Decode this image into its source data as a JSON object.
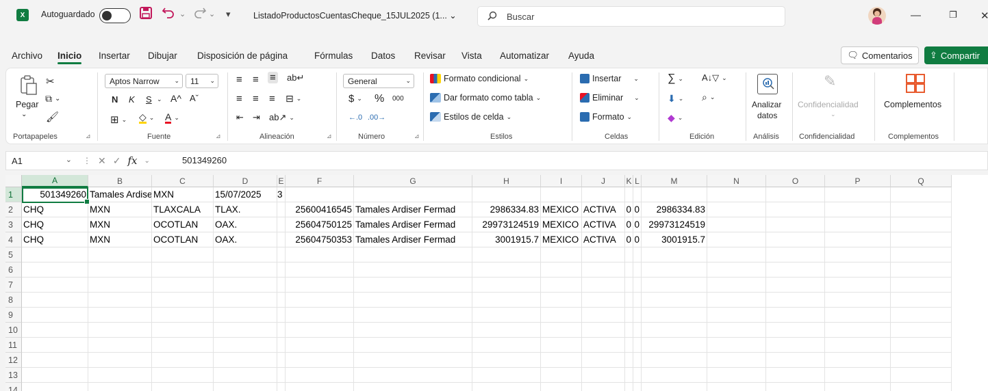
{
  "titlebar": {
    "autosave_label": "Autoguardado",
    "doc_title": "ListadoProductosCuentasCheque_15JUL2025 (1... ⌄",
    "search_placeholder": "Buscar",
    "logo_text": "X",
    "icons": [
      "save-icon",
      "undo-icon",
      "redo-icon",
      "customize-toolbar-icon",
      "search-icon"
    ]
  },
  "menu": {
    "tabs": [
      "Archivo",
      "Inicio",
      "Insertar",
      "Dibujar",
      "Disposición de página",
      "Fórmulas",
      "Datos",
      "Revisar",
      "Vista",
      "Automatizar",
      "Ayuda"
    ],
    "active_tab": "Inicio",
    "comments_label": "Comentarios",
    "share_label": "Compartir"
  },
  "ribbon": {
    "clipboard": {
      "paste_label": "Pegar",
      "group_label": "Portapapeles"
    },
    "font": {
      "font_name": "Aptos Narrow",
      "font_size": "11",
      "bold": "N",
      "italic": "K",
      "underline": "S",
      "grow": "A^",
      "shrink": "Aˇ",
      "group_label": "Fuente"
    },
    "alignment": {
      "group_label": "Alineación"
    },
    "number": {
      "format": "General",
      "currency": "$",
      "percent": "%",
      "thousands": "000",
      "group_label": "Número"
    },
    "styles": {
      "conditional": "Formato condicional",
      "as_table": "Dar formato como tabla",
      "cell_styles": "Estilos de celda",
      "group_label": "Estilos"
    },
    "cells": {
      "insert": "Insertar",
      "delete": "Eliminar",
      "format": "Formato",
      "group_label": "Celdas"
    },
    "editing": {
      "group_label": "Edición"
    },
    "analysis": {
      "analyze_label_1": "Analizar",
      "analyze_label_2": "datos",
      "group_label": "Análisis"
    },
    "sensitivity": {
      "button_label": "Confidencialidad",
      "group_label": "Confidencialidad"
    },
    "addins": {
      "button_label": "Complementos",
      "group_label": "Complementos"
    }
  },
  "formula_bar": {
    "name_box": "A1",
    "fx": "fx",
    "value": "501349260"
  },
  "sheet": {
    "columns": [
      "A",
      "B",
      "C",
      "D",
      "E",
      "F",
      "G",
      "H",
      "I",
      "J",
      "K",
      "L",
      "M",
      "N",
      "O",
      "P",
      "Q"
    ],
    "row_numbers": [
      "1",
      "2",
      "3",
      "4",
      "5",
      "6",
      "7",
      "8",
      "9",
      "10",
      "11",
      "12",
      "13",
      "14"
    ],
    "rows": [
      [
        "501349260",
        "Tamales Ardiser Fermad",
        "MXN",
        "15/07/2025",
        "3",
        "",
        "",
        "",
        "",
        "",
        "",
        "",
        ""
      ],
      [
        "CHQ",
        "MXN",
        "TLAXCALA",
        "TLAX.",
        "",
        "25600416545",
        "Tamales Ardiser Fermad",
        "2986334.83",
        "MEXICO",
        "ACTIVA",
        "0",
        "0",
        "2986334.83"
      ],
      [
        "CHQ",
        "MXN",
        "OCOTLAN",
        "OAX.",
        "",
        "25604750125",
        "Tamales Ardiser Fermad",
        "29973124519",
        "MEXICO",
        "ACTIVA",
        "0",
        "0",
        "29973124519"
      ],
      [
        "CHQ",
        "MXN",
        "OCOTLAN",
        "OAX.",
        "",
        "25604750353",
        "Tamales Ardiser Fermad",
        "3001915.7",
        "MEXICO",
        "ACTIVA",
        "0",
        "0",
        "3001915.7"
      ]
    ]
  },
  "colors": {
    "accent": "#107c41",
    "save_icon": "#c2185b"
  }
}
